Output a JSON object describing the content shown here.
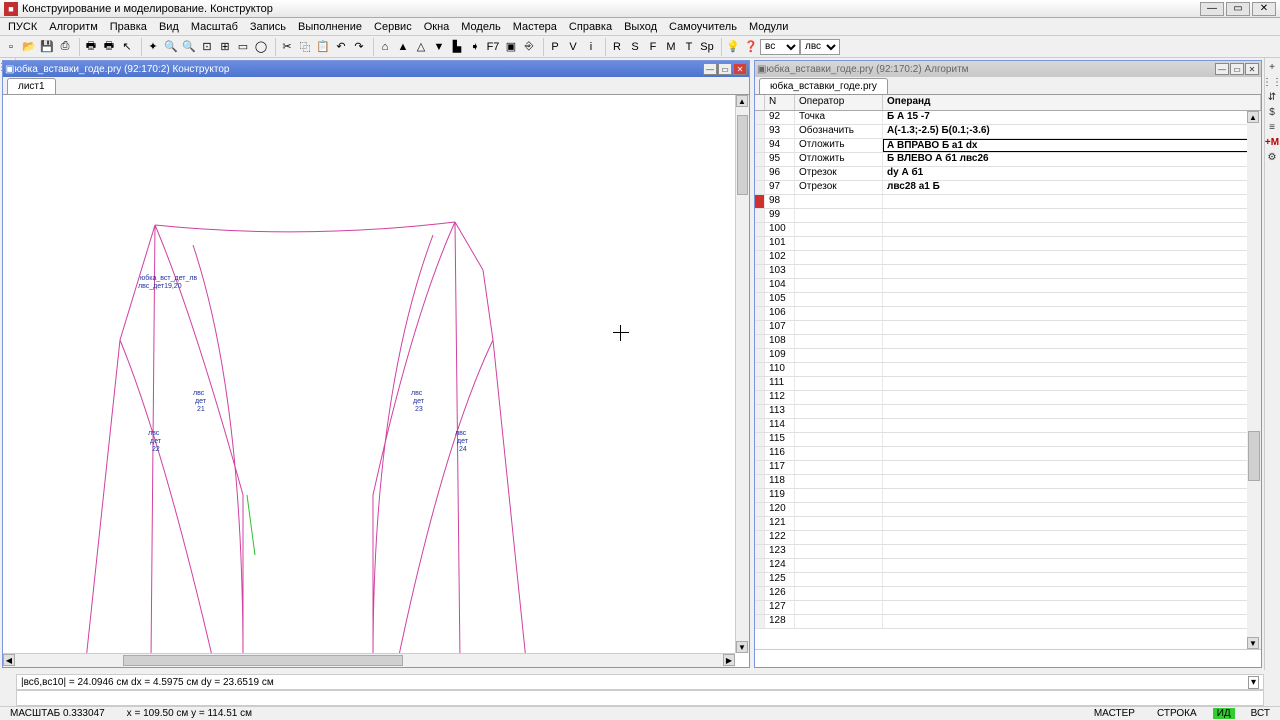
{
  "title": "Конструирование и моделирование. Конструктор",
  "menus": [
    "ПУСК",
    "Алгоритм",
    "Правка",
    "Вид",
    "Масштаб",
    "Запись",
    "Выполнение",
    "Сервис",
    "Окна",
    "Модель",
    "Мастера",
    "Справка",
    "Выход",
    "Самоучитель",
    "Модули"
  ],
  "toolbar_letters": [
    "F7",
    "P",
    "V",
    "i",
    "R",
    "S",
    "F",
    "M",
    "T",
    "Sp"
  ],
  "combo1": "вс",
  "combo2": "лвс",
  "left_panel": {
    "title": "юбка_вставки_годе.pry (92:170:2) Конструктор",
    "tab": "лист1"
  },
  "right_panel": {
    "title": "юбка_вставки_годе.pry (92:170:2) Алгоритм",
    "tab": "юбка_вставки_годе.pry"
  },
  "grid": {
    "headers": {
      "n": "N",
      "op": "Оператор",
      "operand": "Операнд"
    },
    "rows": [
      {
        "n": "92",
        "op": "Точка",
        "operand": "Б А 15 -7"
      },
      {
        "n": "93",
        "op": "Обозначить",
        "operand": "А(-1.3;-2.5) Б(0.1;-3.6)"
      },
      {
        "n": "94",
        "op": "Отложить",
        "operand": "А ВПРАВО Б а1 dx",
        "sel": true
      },
      {
        "n": "95",
        "op": "Отложить",
        "operand": "Б ВЛЕВО А б1 лвс26"
      },
      {
        "n": "96",
        "op": "Отрезок",
        "operand": "dy А б1"
      },
      {
        "n": "97",
        "op": "Отрезок",
        "operand": "лвс28 а1 Б"
      },
      {
        "n": "98",
        "op": "",
        "operand": "",
        "marker": "red"
      },
      {
        "n": "99",
        "op": "",
        "operand": ""
      },
      {
        "n": "100",
        "op": "",
        "operand": ""
      },
      {
        "n": "101",
        "op": "",
        "operand": ""
      },
      {
        "n": "102",
        "op": "",
        "operand": ""
      },
      {
        "n": "103",
        "op": "",
        "operand": ""
      },
      {
        "n": "104",
        "op": "",
        "operand": ""
      },
      {
        "n": "105",
        "op": "",
        "operand": ""
      },
      {
        "n": "106",
        "op": "",
        "operand": ""
      },
      {
        "n": "107",
        "op": "",
        "operand": ""
      },
      {
        "n": "108",
        "op": "",
        "operand": ""
      },
      {
        "n": "109",
        "op": "",
        "operand": ""
      },
      {
        "n": "110",
        "op": "",
        "operand": ""
      },
      {
        "n": "111",
        "op": "",
        "operand": ""
      },
      {
        "n": "112",
        "op": "",
        "operand": ""
      },
      {
        "n": "113",
        "op": "",
        "operand": ""
      },
      {
        "n": "114",
        "op": "",
        "operand": ""
      },
      {
        "n": "115",
        "op": "",
        "operand": ""
      },
      {
        "n": "116",
        "op": "",
        "operand": ""
      },
      {
        "n": "117",
        "op": "",
        "operand": ""
      },
      {
        "n": "118",
        "op": "",
        "operand": ""
      },
      {
        "n": "119",
        "op": "",
        "operand": ""
      },
      {
        "n": "120",
        "op": "",
        "operand": ""
      },
      {
        "n": "121",
        "op": "",
        "operand": ""
      },
      {
        "n": "122",
        "op": "",
        "operand": ""
      },
      {
        "n": "123",
        "op": "",
        "operand": ""
      },
      {
        "n": "124",
        "op": "",
        "operand": ""
      },
      {
        "n": "125",
        "op": "",
        "operand": ""
      },
      {
        "n": "126",
        "op": "",
        "operand": ""
      },
      {
        "n": "127",
        "op": "",
        "operand": ""
      },
      {
        "n": "128",
        "op": "",
        "operand": ""
      }
    ]
  },
  "info_text": "|вс6,вс10| = 24.0946 см   dx = 4.5975 см   dy = 23.6519 см",
  "status": {
    "scale": "МАСШТАБ 0.333047",
    "coords": "x = 109.50 см   y = 114.51 см",
    "master": "МАСТЕР",
    "line": "СТРОКА",
    "id": "ИД",
    "layer": "ВСТ"
  }
}
